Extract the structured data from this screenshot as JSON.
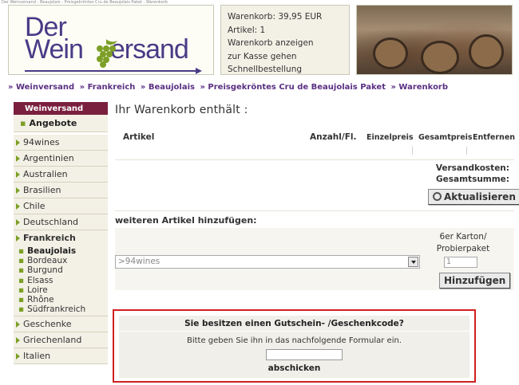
{
  "topbar": {
    "text": "Der Weinversand - Beaujolais - Preisgekröntes Cru de Beaujolais Paket - Warenkorb"
  },
  "logo": {
    "line1": "Der",
    "line2": "Wein",
    "line2b": "ersand"
  },
  "cart": {
    "total": "Warenkorb: 39,95 EUR",
    "items": "Artikel: 1",
    "show": "Warenkorb anzeigen",
    "checkout": "zur Kasse gehen",
    "quick": "Schnellbestellung"
  },
  "breadcrumb": [
    "» Weinversand",
    "» Frankreich",
    "» Beaujolais",
    "» Preisgekröntes Cru de Beaujolais Paket",
    "» Warenkorb"
  ],
  "sidebar": {
    "head": "Weinversand",
    "sub": "Angebote",
    "items": [
      "94wines",
      "Argentinien",
      "Australien",
      "Brasilien",
      "Chile",
      "Deutschland"
    ],
    "active_country": "Frankreich",
    "regions": [
      "Beaujolais",
      "Bordeaux",
      "Burgund",
      "Elsass",
      "Loire",
      "Rhône",
      "Südfrankreich"
    ],
    "items_after": [
      "Geschenke",
      "Griechenland",
      "Italien"
    ]
  },
  "main": {
    "title": "Ihr Warenkorb enthält :",
    "col_article": "Artikel",
    "col_qty": "Anzahl/Fl.",
    "col_unit": "Einzelpreis",
    "col_total": "Gesamtpreis",
    "col_remove": "Entfernen",
    "shipping": "Versandkosten:",
    "sum": "Gesamtsumme:",
    "update_btn": "Aktualisieren",
    "add_title": "weiteren Artikel hinzufügen:",
    "carton_line1": "6er Karton/",
    "carton_line2": "Probierpaket",
    "select_value": ">94wines",
    "qty_value": "1",
    "add_btn": "Hinzufügen"
  },
  "voucher": {
    "head": "Sie besitzen einen Gutschein- /Geschenkcode?",
    "text": "Bitte geben Sie ihn in das nachfolgende Formular ein.",
    "submit": "abschicken"
  }
}
